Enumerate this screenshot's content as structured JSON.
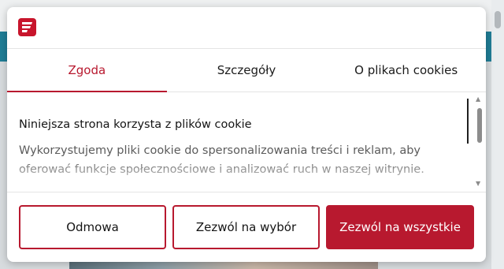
{
  "brand": {
    "accent": "#b8192f",
    "logo": "brand-logo-icon"
  },
  "tabs": [
    {
      "label": "Zgoda",
      "active": true
    },
    {
      "label": "Szczegóły",
      "active": false
    },
    {
      "label": "O plikach cookies",
      "active": false
    }
  ],
  "content": {
    "title": "Niniejsza strona korzysta z plików cookie",
    "text": "Wykorzystujemy pliki cookie do spersonalizowania treści i reklam, aby oferować funkcje społecznościowe i analizować ruch w naszej witrynie."
  },
  "buttons": {
    "deny": "Odmowa",
    "allow_selection": "Zezwól na wybór",
    "allow_all": "Zezwól na wszystkie"
  }
}
